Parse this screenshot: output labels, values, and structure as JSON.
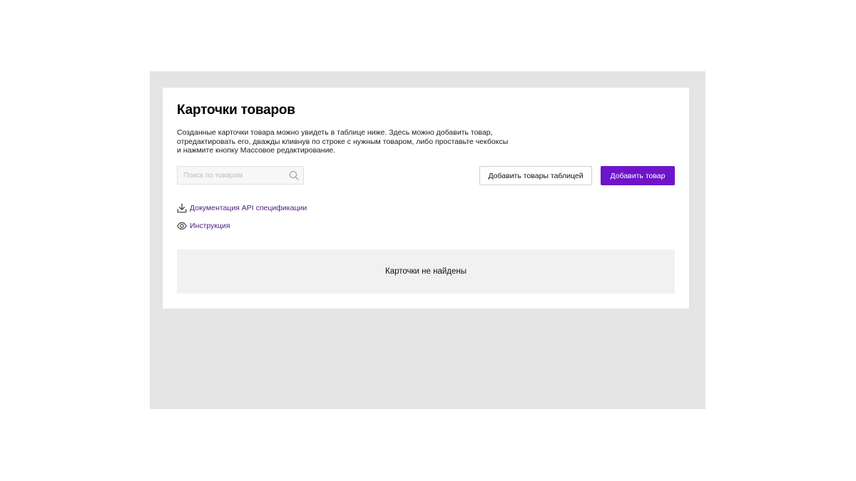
{
  "page": {
    "title": "Карточки товаров",
    "description": "Созданные карточки товара можно увидеть в таблице ниже. Здесь можно добавить товар, отредактировать его, дважды кливнув по строке с нужным товаром, либо проставьте чекбоксы и нажмите кнопку Массовое редактирование."
  },
  "search": {
    "placeholder": "Поиск по товарам",
    "value": "",
    "icon": "search-icon"
  },
  "actions": {
    "add_table_label": "Добавить товары таблицей",
    "add_product_label": "Добавить товар"
  },
  "links": {
    "api_docs": {
      "label": "Документация API спецификации",
      "icon": "download-icon"
    },
    "instructions": {
      "label": "Инструкция",
      "icon": "eye-icon"
    }
  },
  "empty_state": {
    "message": "Карточки не найдены"
  },
  "colors": {
    "primary": "#6e15c9",
    "link": "#4e1a85",
    "frame_background": "#e4e4e4",
    "empty_background": "#f1f1f1"
  }
}
